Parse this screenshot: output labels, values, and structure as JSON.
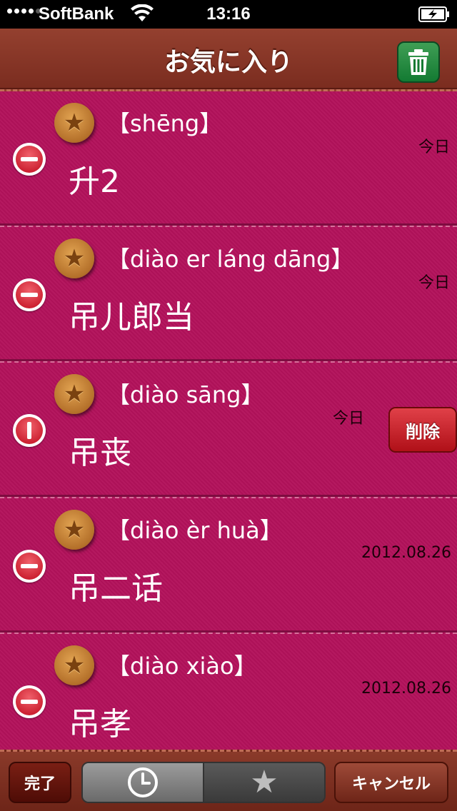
{
  "status_bar": {
    "carrier": "SoftBank",
    "time": "13:16",
    "wifi_icon": "wifi-icon",
    "battery_icon": "battery-charging-icon"
  },
  "nav": {
    "title": "お気に入り",
    "trash_icon": "trash-icon"
  },
  "entries": [
    {
      "pinyin": "【shēng】",
      "hanzi": "升2",
      "date": "今日"
    },
    {
      "pinyin": "【diào er láng dāng】",
      "hanzi": "吊儿郎当",
      "date": "今日"
    },
    {
      "pinyin": "【diào sāng】",
      "hanzi": "吊丧",
      "date": "今日",
      "delete_label": "削除"
    },
    {
      "pinyin": "【diào èr huà】",
      "hanzi": "吊二话",
      "date": "2012.08.26"
    },
    {
      "pinyin": "【diào xiào】",
      "hanzi": "吊孝",
      "date": "2012.08.26"
    }
  ],
  "toolbar": {
    "done_label": "完了",
    "history_icon": "clock-icon",
    "favorites_icon": "star-icon",
    "cancel_label": "キャンセル"
  },
  "colors": {
    "row_background": "#b3125b",
    "nav_background": "#8a3a2a",
    "delete_red": "#c00c1e",
    "trash_green": "#1a8a3a",
    "badge_gold": "#c9853a"
  }
}
